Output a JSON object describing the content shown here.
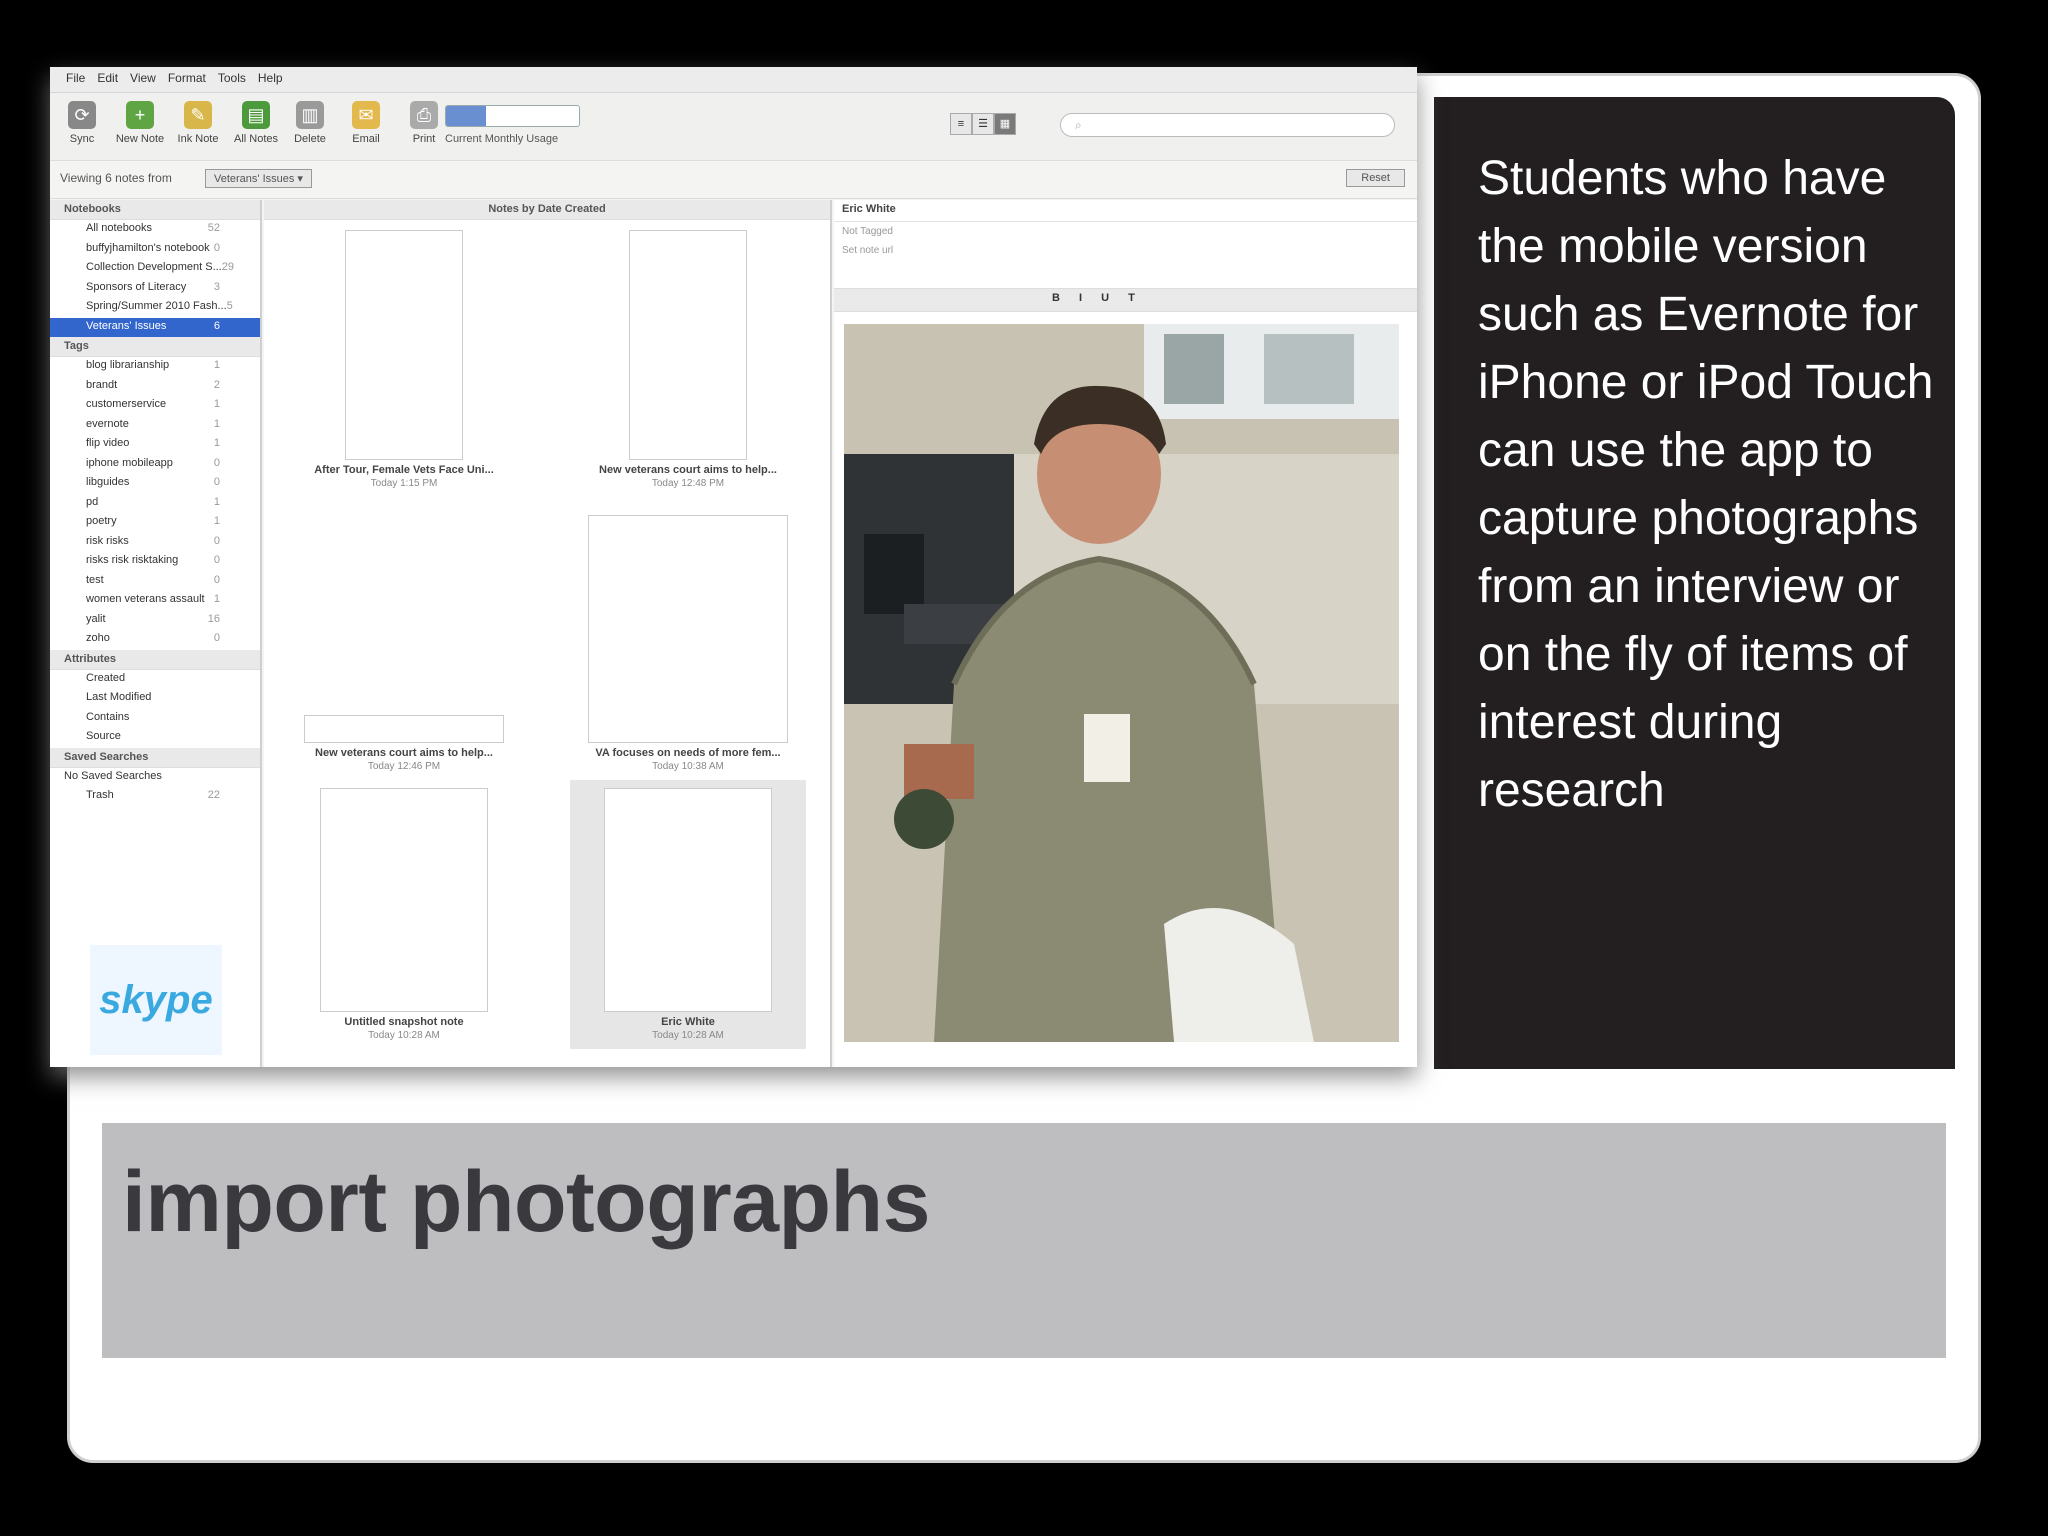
{
  "slide": {
    "side_text": "Students who have the mobile version such as Evernote for iPhone or iPod Touch can use the app to capture photographs from an interview or on the fly of items of interest  during research",
    "title": "import photographs"
  },
  "app": {
    "menu": [
      "File",
      "Edit",
      "View",
      "Format",
      "Tools",
      "Help"
    ],
    "toolbar": [
      {
        "label": "Sync",
        "icon": "sync-icon"
      },
      {
        "label": "New Note",
        "icon": "new-note-icon"
      },
      {
        "label": "Ink Note",
        "icon": "ink-note-icon"
      },
      {
        "label": "All Notes",
        "icon": "all-notes-icon"
      },
      {
        "label": "Delete",
        "icon": "trash-icon"
      },
      {
        "label": "Email",
        "icon": "email-icon"
      },
      {
        "label": "Print",
        "icon": "print-icon"
      }
    ],
    "usage_label": "Current Monthly Usage",
    "filter": {
      "prefix": "Viewing 6 notes from",
      "notebook": "Veterans' Issues ▾",
      "reset": "Reset"
    },
    "notebooks_head": "Notebooks",
    "notebooks": [
      {
        "name": "All notebooks",
        "count": "52"
      },
      {
        "name": "buffyjhamilton's notebook",
        "count": "0"
      },
      {
        "name": "Collection Development S...",
        "count": "29"
      },
      {
        "name": "Sponsors of Literacy",
        "count": "3"
      },
      {
        "name": "Spring/Summer 2010 Fash...",
        "count": "5"
      },
      {
        "name": "Veterans' Issues",
        "count": "6"
      }
    ],
    "tags_head": "Tags",
    "tags": [
      {
        "name": "blog librarianship",
        "count": "1"
      },
      {
        "name": "brandt",
        "count": "2"
      },
      {
        "name": "customerservice",
        "count": "1"
      },
      {
        "name": "evernote",
        "count": "1"
      },
      {
        "name": "flip video",
        "count": "1"
      },
      {
        "name": "iphone mobileapp",
        "count": "0"
      },
      {
        "name": "libguides",
        "count": "0"
      },
      {
        "name": "pd",
        "count": "1"
      },
      {
        "name": "poetry",
        "count": "1"
      },
      {
        "name": "risk risks",
        "count": "0"
      },
      {
        "name": "risks risk risktaking",
        "count": "0"
      },
      {
        "name": "test",
        "count": "0"
      },
      {
        "name": "women veterans assault",
        "count": "1"
      },
      {
        "name": "yalit",
        "count": "16"
      },
      {
        "name": "zoho",
        "count": "0"
      }
    ],
    "attributes_head": "Attributes",
    "attributes": [
      "Created",
      "Last Modified",
      "Contains",
      "Source"
    ],
    "saved_head": "Saved Searches",
    "saved_none": "No Saved Searches",
    "trash": {
      "name": "Trash",
      "count": "22"
    },
    "list_head": "Notes by Date Created",
    "notes": [
      {
        "title": "After Tour, Female Vets Face Uni...",
        "date": "Today 1:15 PM"
      },
      {
        "title": "New veterans court aims to help...",
        "date": "Today 12:48 PM"
      },
      {
        "title": "New veterans court aims to help...",
        "date": "Today 12:46 PM"
      },
      {
        "title": "VA focuses on needs of more fem...",
        "date": "Today 10:38 AM"
      },
      {
        "title": "Untitled snapshot note",
        "date": "Today 10:28 AM"
      },
      {
        "title": "Eric White",
        "date": "Today 10:28 AM"
      }
    ],
    "editor": {
      "title": "Eric White",
      "tags": "Not Tagged",
      "url": "Set note url",
      "format": "B I U T"
    }
  }
}
